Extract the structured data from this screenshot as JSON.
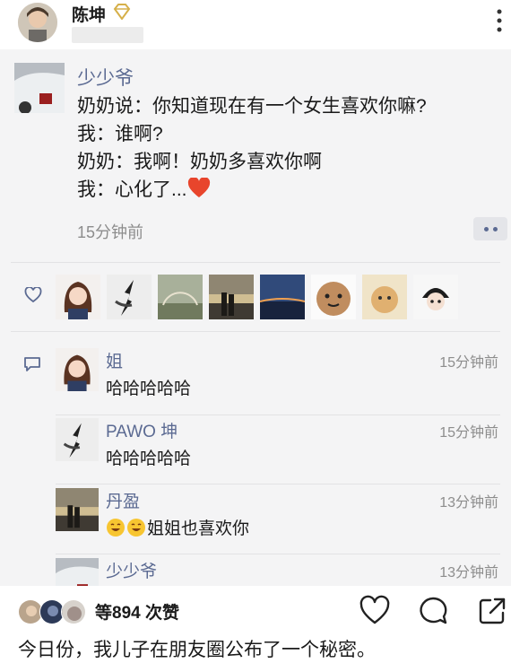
{
  "header": {
    "user_name": "陈坤",
    "badge_icon": "diamond-vip-icon",
    "more_icon": "more-dots-icon"
  },
  "post": {
    "author": "少少爷",
    "lines": [
      "奶奶说：你知道现在有一个女生喜欢你嘛?",
      "我：谁啊?",
      "奶奶：我啊！奶奶多喜欢你啊",
      "我：心化了..."
    ],
    "line4_emoji": "red-heart-emoji",
    "time": "15分钟前"
  },
  "likes": {
    "icon": "heart-outline-icon",
    "avatar_count": 8
  },
  "comments": [
    {
      "name": "姐",
      "text": "哈哈哈哈哈",
      "time": "15分钟前"
    },
    {
      "name": "PAWO 坤",
      "text": "哈哈哈哈哈",
      "time": "15分钟前"
    },
    {
      "name": "丹盈",
      "text": "姐姐也喜欢你",
      "time": "13分钟前",
      "emoji": "grinning-face-emoji"
    },
    {
      "name": "少少爷",
      "text": "",
      "time": "13分钟前"
    }
  ],
  "footer": {
    "like_count": "等894 次赞",
    "icons": [
      "heart-outline-icon",
      "comment-bubble-icon",
      "share-arrow-icon"
    ],
    "caption": "今日份，我儿子在朋友圈公布了一个秘密。"
  },
  "colors": {
    "link_blue": "#5b6a92",
    "card_bg": "#f4f4f5",
    "time_gray": "#8d8d8d"
  }
}
